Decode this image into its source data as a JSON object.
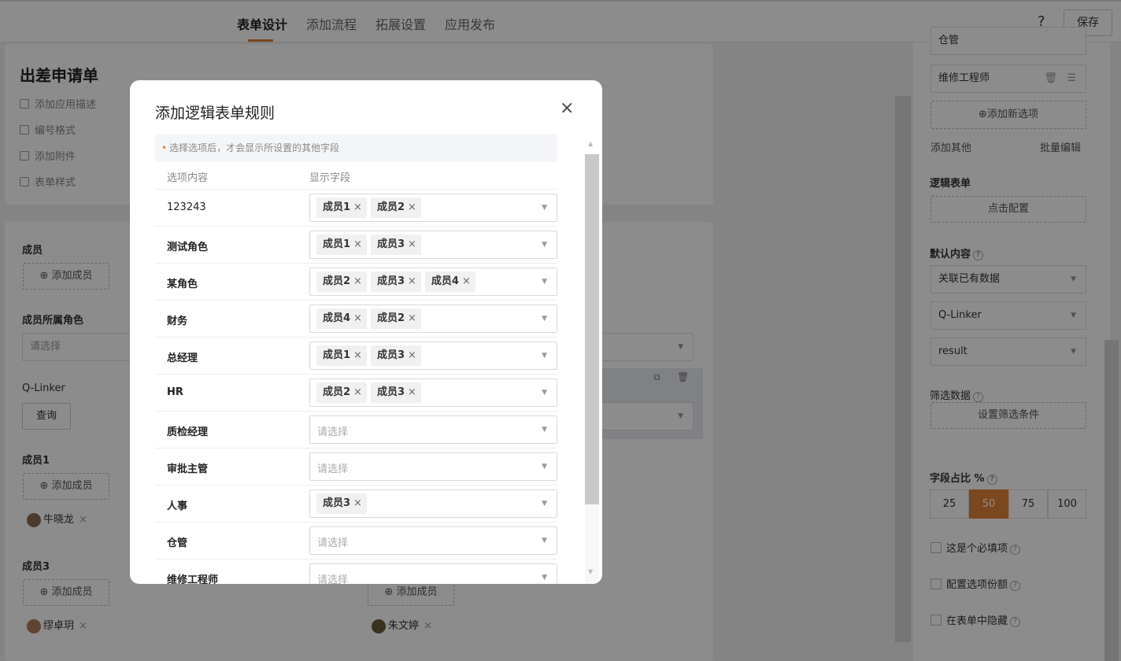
{
  "topbar": {
    "tabs": [
      "表单设计",
      "添加流程",
      "拓展设置",
      "应用发布"
    ],
    "help": "?",
    "save": "保存"
  },
  "form": {
    "title": "出差申请单",
    "links": [
      "添加应用描述",
      "编号格式",
      "添加附件",
      "表单样式"
    ]
  },
  "canvas": {
    "member_label": "成员",
    "add_member": "添加成员",
    "role_label": "成员所属角色",
    "select_placeholder": "请选择",
    "qlinker_label": "Q-Linker",
    "query_btn": "查询",
    "member1_label": "成员1",
    "member1_person": "牛晓龙",
    "member3_label": "成员3",
    "member3_person": "缪卓玥",
    "member_right_person": "朱文婷"
  },
  "right_panel": {
    "option_top": "仓管",
    "option_repair": "维修工程师",
    "add_option": "添加新选项",
    "add_other": "添加其他",
    "batch_edit": "批量编辑",
    "logic_label": "逻辑表单",
    "click_config": "点击配置",
    "default_label": "默认内容",
    "default_select": "关联已有数据",
    "qlinker_select": "Q-Linker",
    "result_select": "result",
    "filter_label": "筛选数据",
    "filter_btn": "设置筛选条件",
    "ratio_label": "字段占比 %",
    "ratios": [
      "25",
      "50",
      "75",
      "100"
    ],
    "ratio_selected": "50",
    "checks": [
      "这是个必填项",
      "配置选项份额",
      "在表单中隐藏"
    ]
  },
  "modal": {
    "title": "添加逻辑表单规则",
    "close": "×",
    "hint": "选择选项后，才会显示所设置的其他字段",
    "col_option": "选项内容",
    "col_fields": "显示字段",
    "placeholder": "请选择",
    "rows": [
      {
        "name": "123243",
        "chips": [
          "成员1",
          "成员2"
        ]
      },
      {
        "name": "测试角色",
        "chips": [
          "成员1",
          "成员3"
        ]
      },
      {
        "name": "某角色",
        "chips": [
          "成员2",
          "成员3",
          "成员4"
        ]
      },
      {
        "name": "财务",
        "chips": [
          "成员4",
          "成员2"
        ]
      },
      {
        "name": "总经理",
        "chips": [
          "成员1",
          "成员3"
        ]
      },
      {
        "name": "HR",
        "chips": [
          "成员2",
          "成员3"
        ]
      },
      {
        "name": "质检经理",
        "chips": []
      },
      {
        "name": "审批主管",
        "chips": []
      },
      {
        "name": "人事",
        "chips": [
          "成员3"
        ]
      },
      {
        "name": "仓管",
        "chips": []
      },
      {
        "name": "维修工程师",
        "chips": []
      }
    ]
  }
}
